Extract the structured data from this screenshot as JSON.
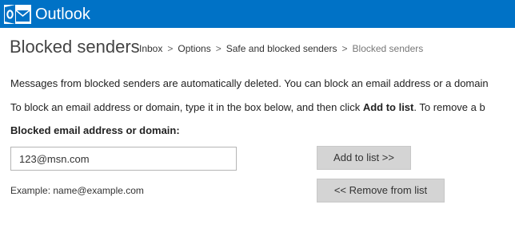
{
  "app": {
    "name": "Outlook",
    "logo_icon": "outlook-logo-icon",
    "brand_color": "#0072c6"
  },
  "page": {
    "title": "Blocked senders"
  },
  "breadcrumb": {
    "items": [
      {
        "label": "Inbox"
      },
      {
        "label": "Options"
      },
      {
        "label": "Safe and blocked senders"
      }
    ],
    "current": "Blocked senders",
    "separator": ">"
  },
  "info": {
    "line1": "Messages from blocked senders are automatically deleted. You can block an email address or a domain",
    "line2_prefix": "To block an email address or domain, type it in the box below, and then click ",
    "line2_bold": "Add to list",
    "line2_suffix": ". To remove a b"
  },
  "form": {
    "field_label": "Blocked email address or domain:",
    "input_value": "123@msn.com",
    "example_text": "Example: name@example.com",
    "add_button": "Add to list >>",
    "remove_button": "<< Remove from list"
  },
  "colors": {
    "button_bg": "#d4d4d4",
    "input_border": "#b5b5b5"
  }
}
